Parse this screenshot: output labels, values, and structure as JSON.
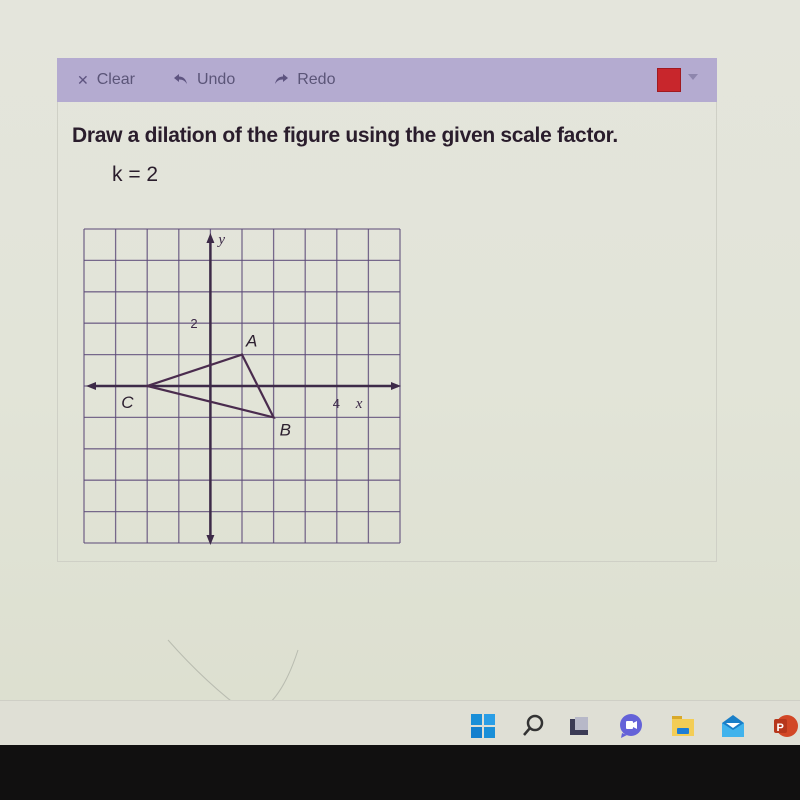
{
  "toolbar": {
    "clear_label": "Clear",
    "clear_icon": "close-icon",
    "undo_label": "Undo",
    "undo_icon": "undo-arrow-icon",
    "redo_label": "Redo",
    "redo_icon": "redo-arrow-icon",
    "selected_color": "#c8262c"
  },
  "question": {
    "prompt": "Draw a dilation of the figure using the given scale factor.",
    "scale_factor": "k = 2"
  },
  "graph": {
    "x_axis_label": "x",
    "y_axis_label": "y",
    "x_tick_label": "4",
    "y_tick_label": "2",
    "x_range": [
      -4,
      6
    ],
    "y_range": [
      -5,
      5
    ],
    "grid_color": "#5c4a78",
    "figure_color": "#4a2c4e",
    "points": [
      {
        "label": "A",
        "x": 1,
        "y": 1
      },
      {
        "label": "B",
        "x": 2,
        "y": -1
      },
      {
        "label": "C",
        "x": -2,
        "y": 0
      }
    ]
  },
  "taskbar": {
    "icons": [
      "windows-start-icon",
      "search-icon",
      "task-view-icon",
      "teams-chat-icon",
      "file-explorer-icon",
      "mail-icon",
      "powerpoint-icon"
    ]
  }
}
